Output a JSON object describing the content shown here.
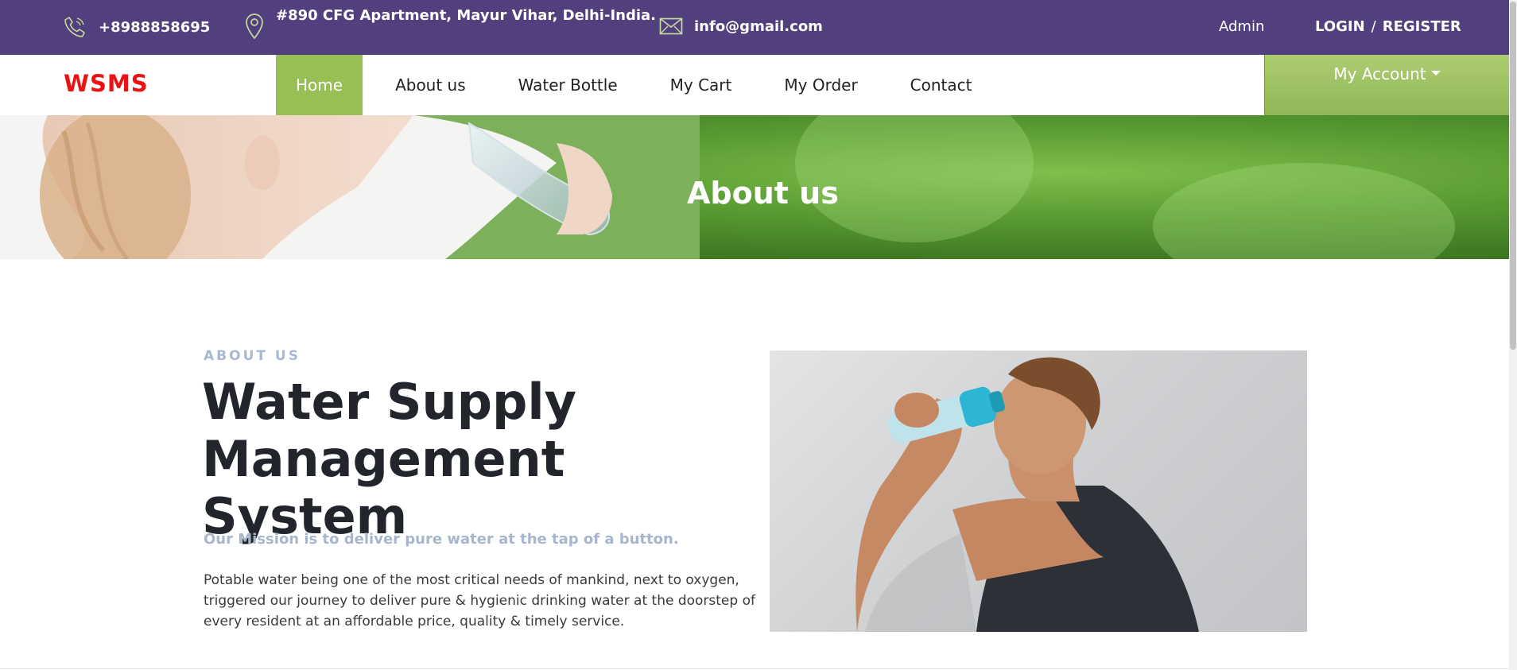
{
  "topbar": {
    "phone": "+8988858695",
    "address": "#890 CFG Apartment, Mayur Vihar, Delhi-India.",
    "email": "info@gmail.com",
    "admin": "Admin",
    "login": "LOGIN",
    "separator": "/",
    "register": "REGISTER",
    "icons": [
      "phone-icon",
      "location-pin-icon",
      "envelope-icon"
    ],
    "color": "#523f7e"
  },
  "navbar": {
    "brand": "WSMS",
    "items": [
      {
        "label": "Home",
        "active": true
      },
      {
        "label": "About us"
      },
      {
        "label": "Water Bottle"
      },
      {
        "label": "My Cart"
      },
      {
        "label": "My Order"
      },
      {
        "label": "Contact"
      }
    ],
    "account": "My Account",
    "accent": "#98bf55"
  },
  "hero": {
    "title": "About us"
  },
  "about": {
    "eyebrow": "ABOUT US",
    "heading_line1": "Water Supply",
    "heading_line2": "Management System",
    "mission": "Our Mission is to deliver pure water at the tap of a button.",
    "paragraph": "Potable water being one of the most critical needs of mankind, next to oxygen, triggered our journey to deliver pure & hygienic drinking water at the doorstep of every resident at an affordable price, quality & timely service."
  }
}
